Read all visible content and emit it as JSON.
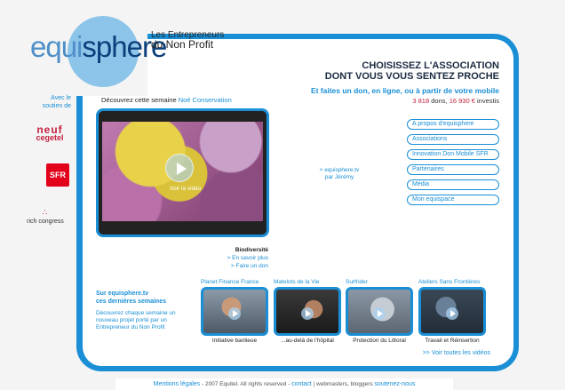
{
  "logo": {
    "part1": "equi",
    "part2": "sphere",
    "tagline1": "Les Entrepreneurs",
    "tagline2": "du Non Profit"
  },
  "sponsors": {
    "avec": "Avec le soutien de",
    "neuf1": "neuf",
    "neuf2": "cegetel",
    "sfr": "SFR",
    "rich": "rich congress"
  },
  "header": {
    "title_line1": "CHOISISSEZ L'ASSOCIATION",
    "title_line2": "DONT VOUS VOUS SENTEZ PROCHE",
    "subtitle": "Et faites un don, en ligne, ou à partir de votre mobile",
    "stats": {
      "dons_count": "3 818",
      "dons_label": "dons,",
      "investis_amount": "16 930 €",
      "investis_label": "investis"
    }
  },
  "featured": {
    "intro": "Découvrez cette semaine",
    "org": "Noé Conservation",
    "watch_label": "Voir la vidéo",
    "category": "Biodiversité",
    "more_link": "> En savoir plus",
    "donate_link": "> Faire un don"
  },
  "equisphere_tv": {
    "line1": "> equisphere.tv",
    "line2": "par Jérémy"
  },
  "nav_buttons": [
    "A propos d'equisphere",
    "Associations",
    "Innovation Don Mobile SFR",
    "Partenaires",
    "Média",
    "Mon equispace"
  ],
  "tv_section": {
    "heading1": "Sur equisphere.tv",
    "heading2": "ces dernières semaines",
    "description": "Découvrez chaque semaine un nouveau projet porté par un Entrepreneur du Non Profit"
  },
  "videos": [
    {
      "org": "Planet Finance France",
      "caption": "Initiative banlieue"
    },
    {
      "org": "Matelots de la Vie",
      "caption": "...au-delà de l'hôpital"
    },
    {
      "org": "Surfrider",
      "caption": "Protection du Littoral"
    },
    {
      "org": "Ateliers Sans Frontières",
      "caption": "Travail et Réinsertion"
    }
  ],
  "all_videos": ">> Voir toutes les vidéos",
  "footer": {
    "legal": "Mentions légales",
    "copyright": " - 2007 Equitel. All rights reserved - ",
    "contact": "contact",
    "middle": " | webmasters, bloggers ",
    "soutenez": "soutenez-nous"
  },
  "colors": {
    "accent": "#1a8fd6",
    "highlight": "#c41f3d",
    "logo_circle": "#8cc4ea"
  }
}
